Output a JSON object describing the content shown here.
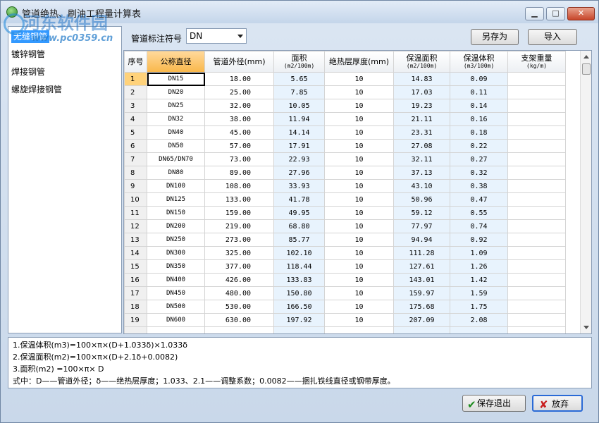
{
  "window": {
    "title": "管道绝热、刷油工程量计算表",
    "watermark": "河东软件园",
    "watermark_url": "www.pc0359.cn",
    "minimize_glyph": "▁",
    "maximize_glyph": "□",
    "close_glyph": "✕"
  },
  "left_list": {
    "items": [
      {
        "label": "无缝钢管",
        "selected": true
      },
      {
        "label": "镀锌钢管",
        "selected": false
      },
      {
        "label": "焊接钢管",
        "selected": false
      },
      {
        "label": "螺旋焊接钢管",
        "selected": false
      }
    ]
  },
  "toolbar": {
    "pipe_symbol_label": "管道标注符号",
    "pipe_symbol_value": "DN",
    "save_as_label": "另存为",
    "import_label": "导入"
  },
  "grid": {
    "headers": [
      {
        "label": "序号",
        "unit": ""
      },
      {
        "label": "公称直径",
        "unit": ""
      },
      {
        "label": "管道外径(mm)",
        "unit": ""
      },
      {
        "label": "面积",
        "unit": "(m2/100m)"
      },
      {
        "label": "绝热层厚度(mm)",
        "unit": ""
      },
      {
        "label": "保温面积",
        "unit": "(m2/100m)"
      },
      {
        "label": "保温体积",
        "unit": "(m3/100m)"
      },
      {
        "label": "支架重量",
        "unit": "(kg/m)"
      }
    ],
    "rows": [
      [
        "1",
        "DN15",
        "18.00",
        "5.65",
        "10",
        "14.83",
        "0.09",
        ""
      ],
      [
        "2",
        "DN20",
        "25.00",
        "7.85",
        "10",
        "17.03",
        "0.11",
        ""
      ],
      [
        "3",
        "DN25",
        "32.00",
        "10.05",
        "10",
        "19.23",
        "0.14",
        ""
      ],
      [
        "4",
        "DN32",
        "38.00",
        "11.94",
        "10",
        "21.11",
        "0.16",
        ""
      ],
      [
        "5",
        "DN40",
        "45.00",
        "14.14",
        "10",
        "23.31",
        "0.18",
        ""
      ],
      [
        "6",
        "DN50",
        "57.00",
        "17.91",
        "10",
        "27.08",
        "0.22",
        ""
      ],
      [
        "7",
        "DN65/DN70",
        "73.00",
        "22.93",
        "10",
        "32.11",
        "0.27",
        ""
      ],
      [
        "8",
        "DN80",
        "89.00",
        "27.96",
        "10",
        "37.13",
        "0.32",
        ""
      ],
      [
        "9",
        "DN100",
        "108.00",
        "33.93",
        "10",
        "43.10",
        "0.38",
        ""
      ],
      [
        "10",
        "DN125",
        "133.00",
        "41.78",
        "10",
        "50.96",
        "0.47",
        ""
      ],
      [
        "11",
        "DN150",
        "159.00",
        "49.95",
        "10",
        "59.12",
        "0.55",
        ""
      ],
      [
        "12",
        "DN200",
        "219.00",
        "68.80",
        "10",
        "77.97",
        "0.74",
        ""
      ],
      [
        "13",
        "DN250",
        "273.00",
        "85.77",
        "10",
        "94.94",
        "0.92",
        ""
      ],
      [
        "14",
        "DN300",
        "325.00",
        "102.10",
        "10",
        "111.28",
        "1.09",
        ""
      ],
      [
        "15",
        "DN350",
        "377.00",
        "118.44",
        "10",
        "127.61",
        "1.26",
        ""
      ],
      [
        "16",
        "DN400",
        "426.00",
        "133.83",
        "10",
        "143.01",
        "1.42",
        ""
      ],
      [
        "17",
        "DN450",
        "480.00",
        "150.80",
        "10",
        "159.97",
        "1.59",
        ""
      ],
      [
        "18",
        "DN500",
        "530.00",
        "166.50",
        "10",
        "175.68",
        "1.75",
        ""
      ],
      [
        "19",
        "DN600",
        "630.00",
        "197.92",
        "10",
        "207.09",
        "2.08",
        ""
      ],
      [
        "",
        "",
        "",
        "",
        "",
        "",
        "",
        ""
      ]
    ]
  },
  "formulas": [
    "1.保温体积(m3)=100×π×(D+1.033δ)×1.033δ",
    "2.保温面积(m2)=100×π×(D+2.1δ+0.0082)",
    "3.面积(m2)      =100×π× D",
    "式中：D——管道外径；δ——绝热层厚度；1.033、2.1——调整系数；0.0082——捆扎铁线直径或钢带厚度。"
  ],
  "footer": {
    "save_exit_label": "保存退出",
    "discard_label": "放弃",
    "check_glyph": "✔",
    "x_glyph": "✘"
  },
  "colors": {
    "selected_header": "#f9b74a",
    "calc_column": "#e8f3fd",
    "selection_blue": "#3399ff"
  }
}
